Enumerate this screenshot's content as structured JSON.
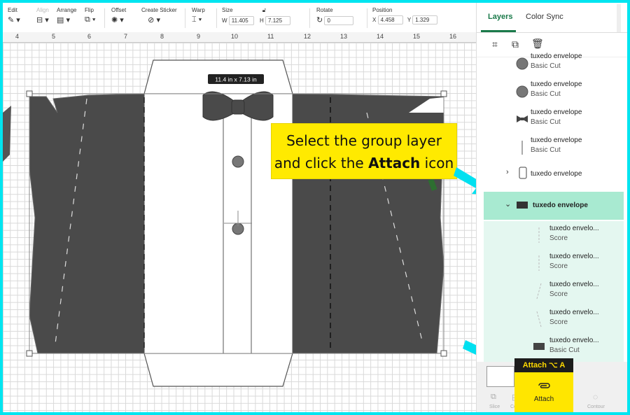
{
  "toolbar": {
    "edit": "Edit",
    "align": "Align",
    "arrange": "Arrange",
    "flip": "Flip",
    "offset": "Offset",
    "create_sticker": "Create Sticker",
    "warp": "Warp",
    "size": "Size",
    "w_label": "W",
    "w_value": "11.405",
    "h_label": "H",
    "h_value": "7.125",
    "rotate": "Rotate",
    "rotate_value": "0",
    "position": "Position",
    "x_label": "X",
    "x_value": "4.458",
    "y_label": "Y",
    "y_value": "1.329"
  },
  "ruler": [
    "4",
    "5",
    "6",
    "7",
    "8",
    "9",
    "10",
    "11",
    "12",
    "13",
    "14",
    "15",
    "16"
  ],
  "canvas": {
    "size_tag": "11.4  in x 7.13  in"
  },
  "callout": {
    "line1": "Select the group layer",
    "line2_pre": "and click the ",
    "line2_bold": "Attach",
    "line2_post": " icon"
  },
  "panel": {
    "tabs": [
      "Layers",
      "Color Sync"
    ],
    "layers": [
      {
        "name": "tuxedo envelope",
        "sub": "Basic Cut"
      },
      {
        "name": "tuxedo envelope",
        "sub": "Basic Cut"
      },
      {
        "name": "tuxedo envelope",
        "sub": "Basic Cut"
      },
      {
        "name": "tuxedo envelope",
        "sub": "Basic Cut"
      },
      {
        "name": "tuxedo envelope",
        "sub": ""
      },
      {
        "name": "tuxedo envelope",
        "sub": ""
      },
      {
        "name": "tuxedo envelo...",
        "sub": "Score"
      },
      {
        "name": "tuxedo envelo...",
        "sub": "Score"
      },
      {
        "name": "tuxedo envelo...",
        "sub": "Score"
      },
      {
        "name": "tuxedo envelo...",
        "sub": "Score"
      },
      {
        "name": "tuxedo envelo...",
        "sub": "Basic Cut"
      }
    ],
    "bottom": {
      "slice": "Slice",
      "combine": "Co",
      "contour": "Contour"
    }
  },
  "attach": {
    "tooltip": "Attach ⌥ A",
    "label": "Attach"
  },
  "colors": {
    "accent": "#1a7a4a",
    "highlight": "#a8ead1",
    "callout": "#ffea00",
    "border": "#00e5f0"
  }
}
